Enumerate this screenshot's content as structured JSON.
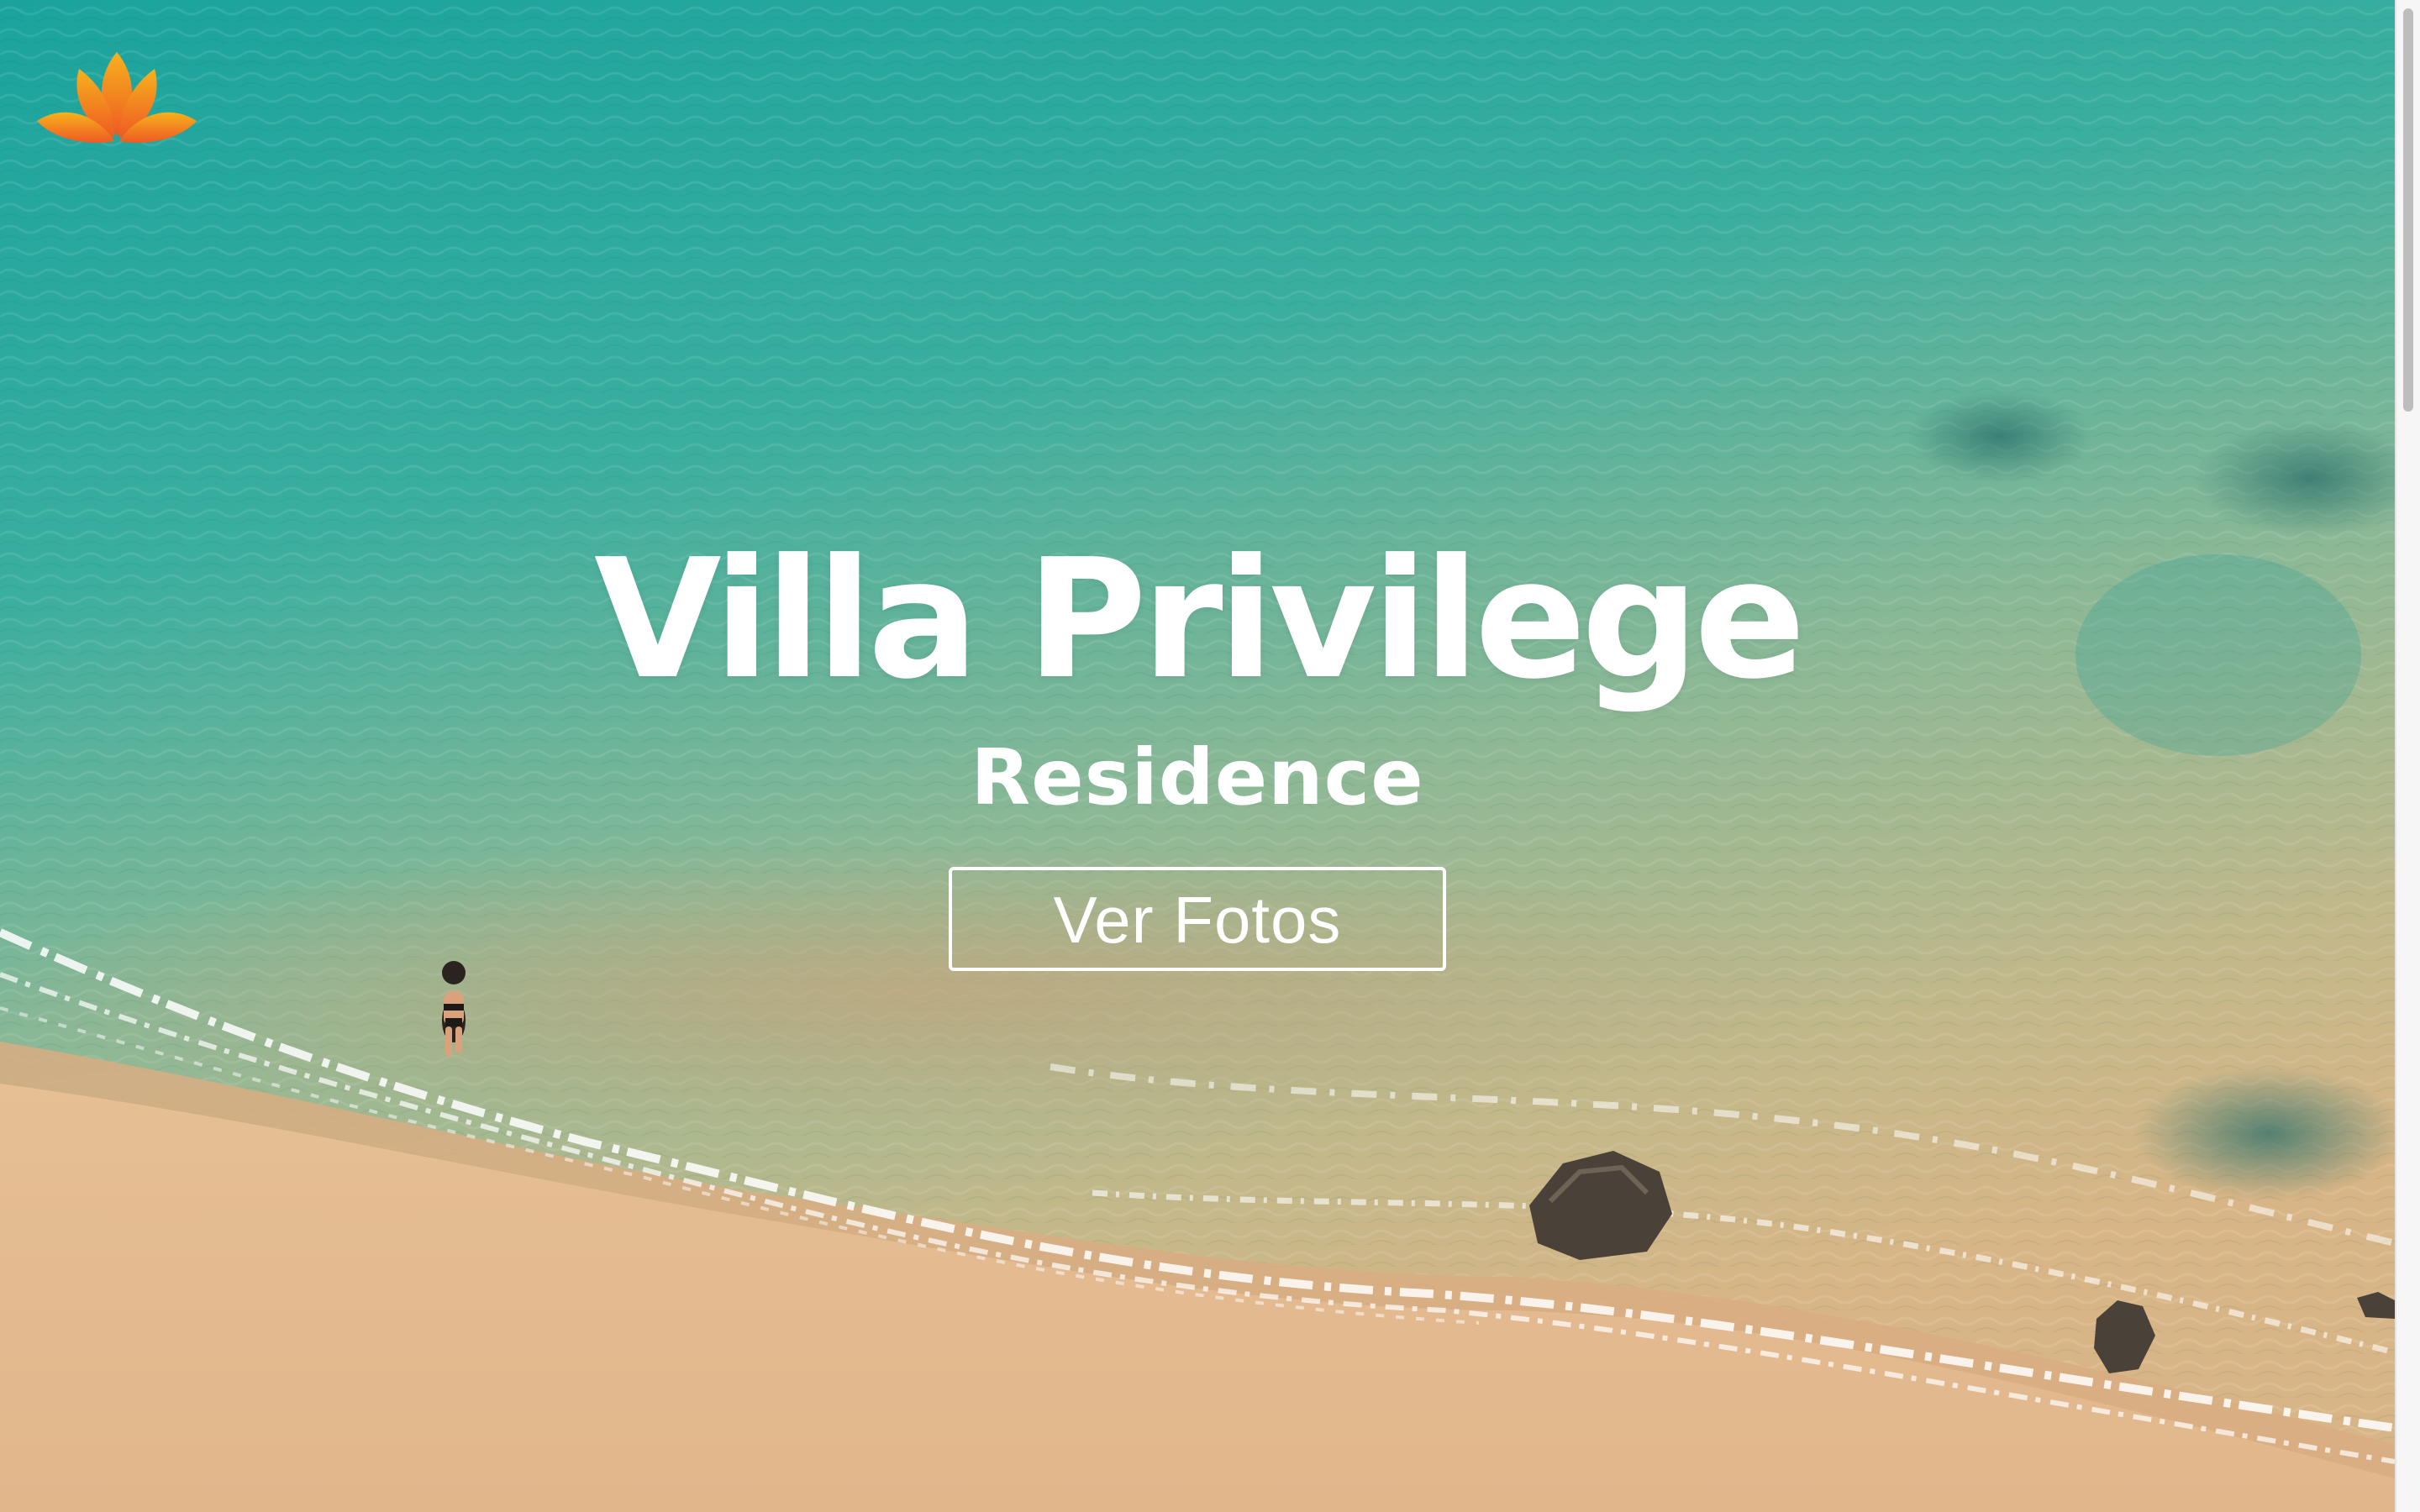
{
  "brand": {
    "logo_icon": "lotus-icon",
    "colors": {
      "logo_gradient_start": "#f7b21c",
      "logo_gradient_end": "#ee5a24"
    }
  },
  "hero": {
    "title": "Villa Privilege",
    "subtitle": "Residence",
    "cta_label": "Ver Fotos",
    "background": "aerial-beach-photo"
  },
  "colors": {
    "text": "#ffffff",
    "water_deep": "#21a7a0",
    "water_shallow": "#7fb79c",
    "sand": "#e3b98f"
  }
}
